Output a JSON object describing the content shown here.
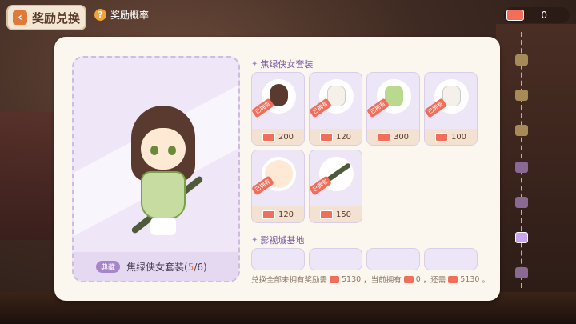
{
  "header": {
    "title": "奖励兑换",
    "probability_label": "奖励概率",
    "currency_value": "0"
  },
  "preview": {
    "badge": "典藏",
    "set_name": "焦绿侠女套装",
    "owned_count": "5",
    "total_count": "6"
  },
  "sections": [
    {
      "title": "焦绿侠女套装",
      "items": [
        {
          "price": "200",
          "owned_label": "已拥有",
          "icon": "hair-item-icon"
        },
        {
          "price": "120",
          "owned_label": "已拥有",
          "icon": "headwear-item-icon"
        },
        {
          "price": "300",
          "owned_label": "已拥有",
          "icon": "dress-item-icon"
        },
        {
          "price": "100",
          "owned_label": "已拥有",
          "icon": "shoes-item-icon"
        },
        {
          "price": "120",
          "owned_label": "已拥有",
          "icon": "face-item-icon"
        },
        {
          "price": "150",
          "owned_label": "已拥有",
          "icon": "sword-item-icon"
        }
      ]
    },
    {
      "title": "影视城基地"
    }
  ],
  "footer": {
    "text_a": "兑换全部未拥有奖励需",
    "needed": "5130",
    "text_b": "，当前拥有",
    "have": "0",
    "text_c": "，还需",
    "remaining": "5130",
    "text_d": "。"
  },
  "colors": {
    "accent_orange": "#e07a3c",
    "ticket_red": "#f26d5a",
    "purple": "#a685c9"
  }
}
